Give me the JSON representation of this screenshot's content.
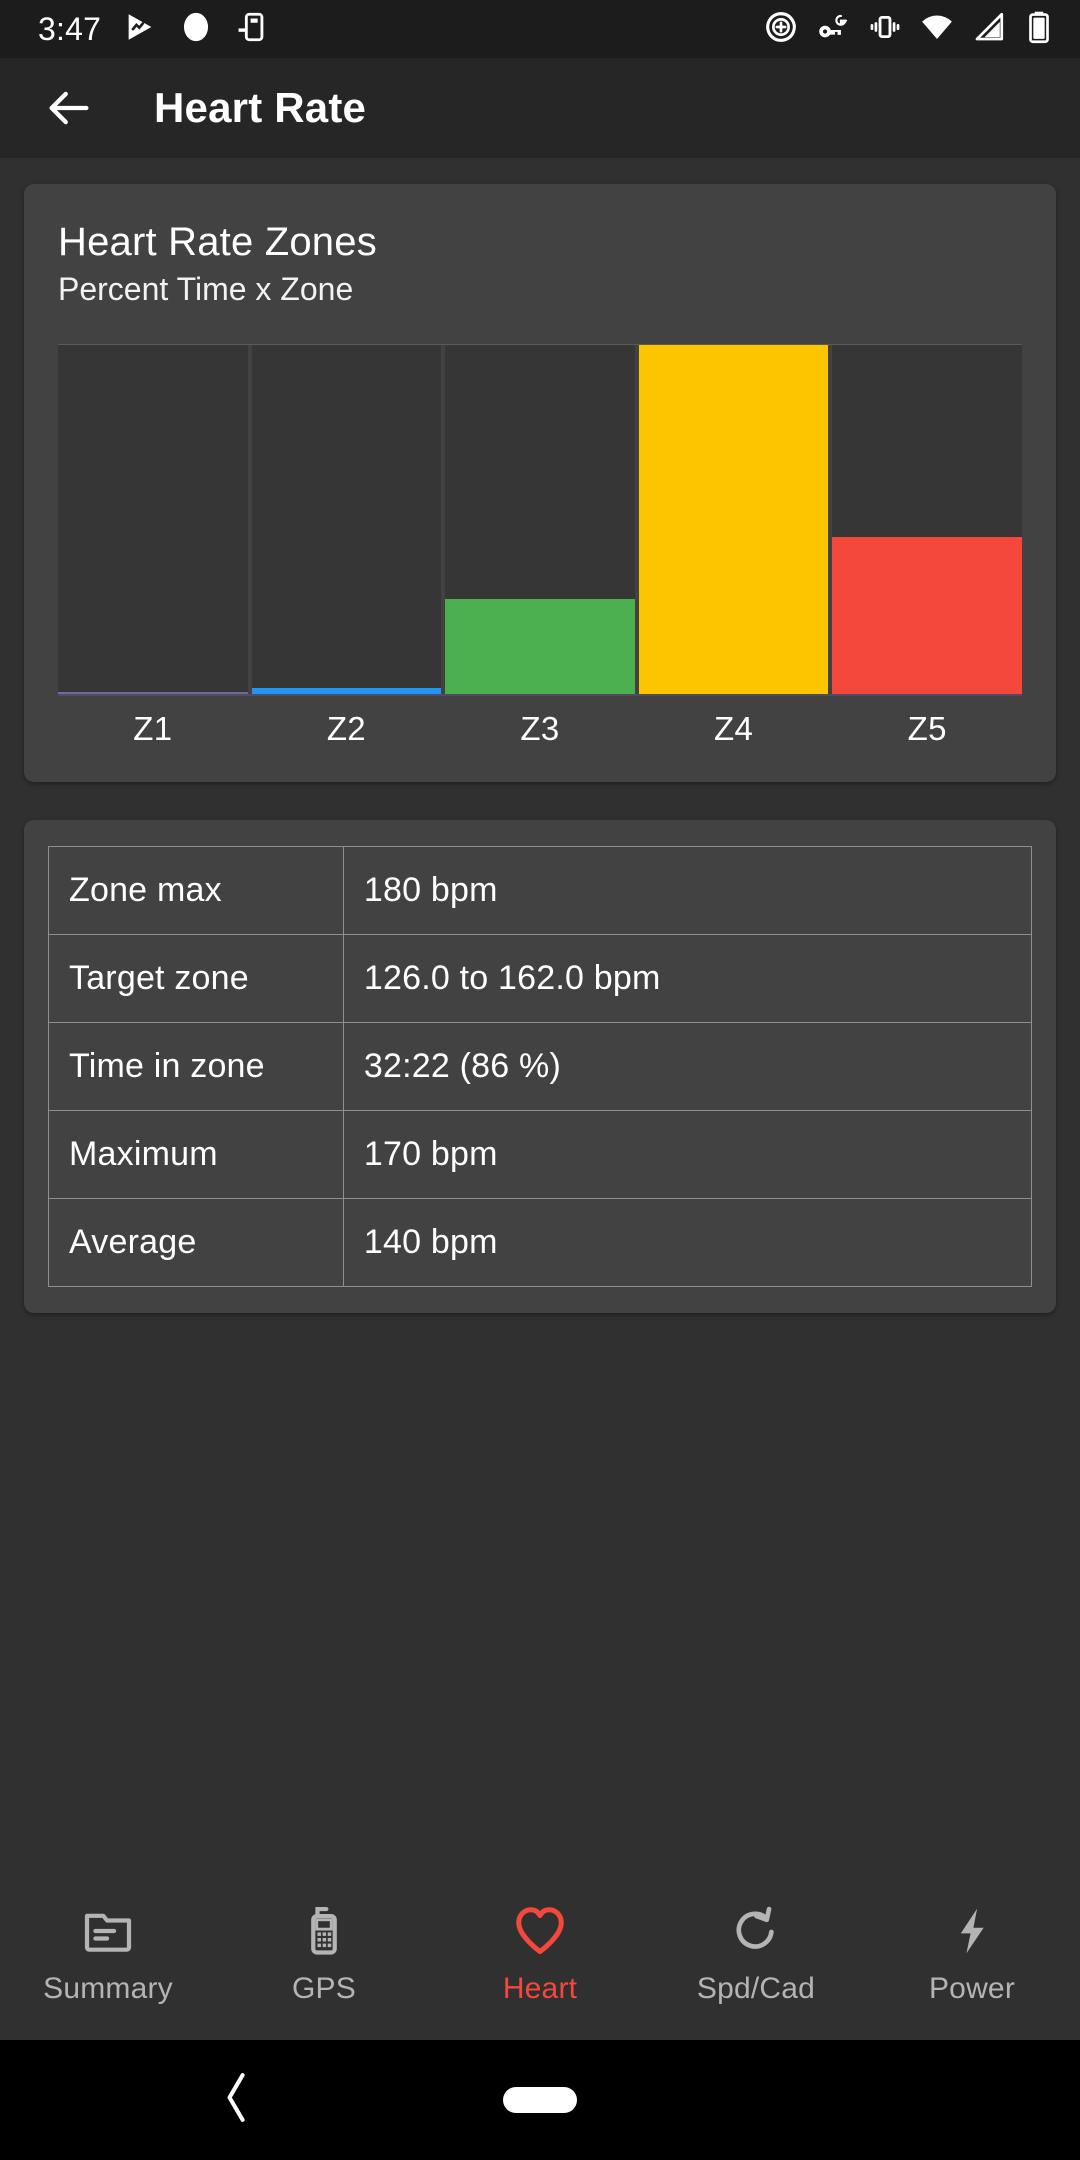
{
  "status_bar": {
    "time": "3:47",
    "left_icons": [
      "play-activity-icon",
      "circle-record-icon",
      "cast-device-icon"
    ],
    "right_icons": [
      "data-saver-icon",
      "google-passkey-icon",
      "vibrate-icon",
      "wifi-icon",
      "cellular-signal-icon",
      "battery-icon"
    ]
  },
  "app_bar": {
    "back_label": "back-arrow-icon",
    "title": "Heart Rate"
  },
  "chart_card": {
    "title": "Heart Rate Zones",
    "subtitle": "Percent Time x Zone"
  },
  "chart_data": {
    "type": "bar",
    "title": "Heart Rate Zones",
    "subtitle": "Percent Time x Zone",
    "xlabel": "",
    "ylabel": "Percent Time",
    "ylim": [
      0,
      100
    ],
    "grid": false,
    "legend": "none",
    "categories": [
      "Z1",
      "Z2",
      "Z3",
      "Z4",
      "Z5"
    ],
    "values": [
      0.5,
      1.5,
      27,
      100,
      45
    ],
    "bar_colors": [
      "#6f6b9b",
      "#2196f3",
      "#4caf50",
      "#fdc500",
      "#f4483c"
    ],
    "track_color": "#363636",
    "axis_color": "#4f4a66"
  },
  "stats": {
    "rows": [
      {
        "key": "Zone max",
        "value": "180 bpm"
      },
      {
        "key": "Target zone",
        "value": "126.0 to 162.0 bpm"
      },
      {
        "key": "Time in zone",
        "value": "32:22 (86 %)"
      },
      {
        "key": "Maximum",
        "value": "170 bpm"
      },
      {
        "key": "Average",
        "value": "140 bpm"
      }
    ]
  },
  "bottom_nav": {
    "active_color": "#f4483c",
    "inactive_color": "#b4b4b4",
    "items": [
      {
        "label": "Summary",
        "icon": "document-icon",
        "active": false
      },
      {
        "label": "GPS",
        "icon": "mobile-phone-icon",
        "active": false
      },
      {
        "label": "Heart",
        "icon": "heart-icon",
        "active": true
      },
      {
        "label": "Spd/Cad",
        "icon": "rotate-ccw-icon",
        "active": false
      },
      {
        "label": "Power",
        "icon": "lightning-bolt-icon",
        "active": false
      }
    ]
  },
  "android_nav": {
    "back": "chevron-back-icon",
    "home": "home-pill-icon"
  }
}
